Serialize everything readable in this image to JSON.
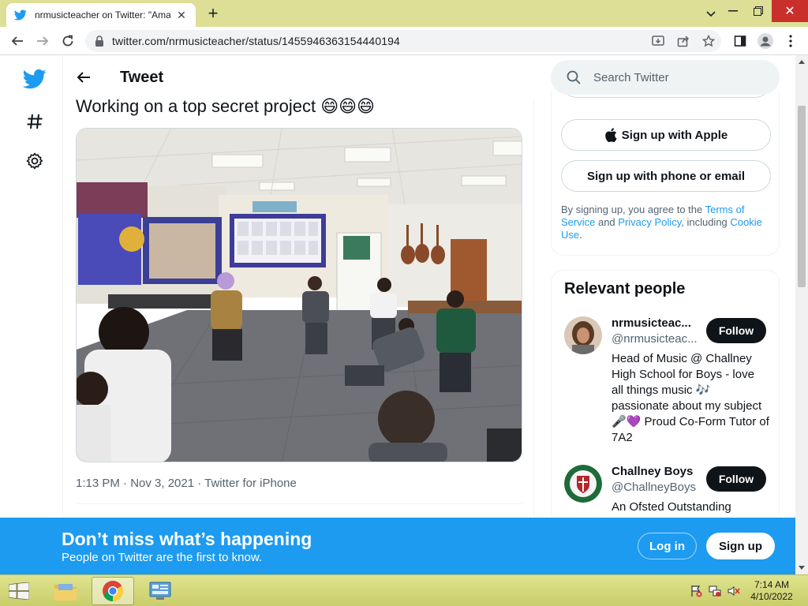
{
  "browser": {
    "tab_title": "nrmusicteacher on Twitter: \"Ama",
    "url": "twitter.com/nrmusicteacher/status/1455946363154440194"
  },
  "header": {
    "title": "Tweet"
  },
  "tweet": {
    "text": "Working on a top secret project 😄😄😄",
    "meta": "1:13 PM · Nov 3, 2021 · Twitter for iPhone"
  },
  "sidebar": {
    "search_placeholder": "Search Twitter",
    "signup_apple": "Sign up with Apple",
    "signup_phone": "Sign up with phone or email",
    "terms_prefix": "By signing up, you agree to the ",
    "terms_link": "Terms of Service",
    "terms_and": " and ",
    "privacy_link": "Privacy Policy",
    "terms_including": ", including ",
    "cookie_link": "Cookie Use",
    "terms_end": "."
  },
  "relevant_people": {
    "title": "Relevant people",
    "people": [
      {
        "name": "nrmusicteac...",
        "handle": "@nrmusicteac...",
        "follow_label": "Follow",
        "bio": "Head of Music @ Challney High School for Boys - love all things music 🎶 passionate about my subject 🎤💜 Proud Co-Form Tutor of 7A2"
      },
      {
        "name": "Challney Boys",
        "handle": "@ChallneyBoys",
        "follow_label": "Follow",
        "bio": "An Ofsted Outstanding"
      }
    ]
  },
  "banner": {
    "title": "Don’t miss what’s happening",
    "subtitle": "People on Twitter are the first to know.",
    "login_label": "Log in",
    "signup_label": "Sign up"
  },
  "taskbar": {
    "time": "7:14 AM",
    "date": "4/10/2022"
  },
  "colors": {
    "twitter_blue": "#1d9bf0",
    "text_primary": "#0f1419",
    "text_secondary": "#536471",
    "follow_button": "#0f1419"
  }
}
